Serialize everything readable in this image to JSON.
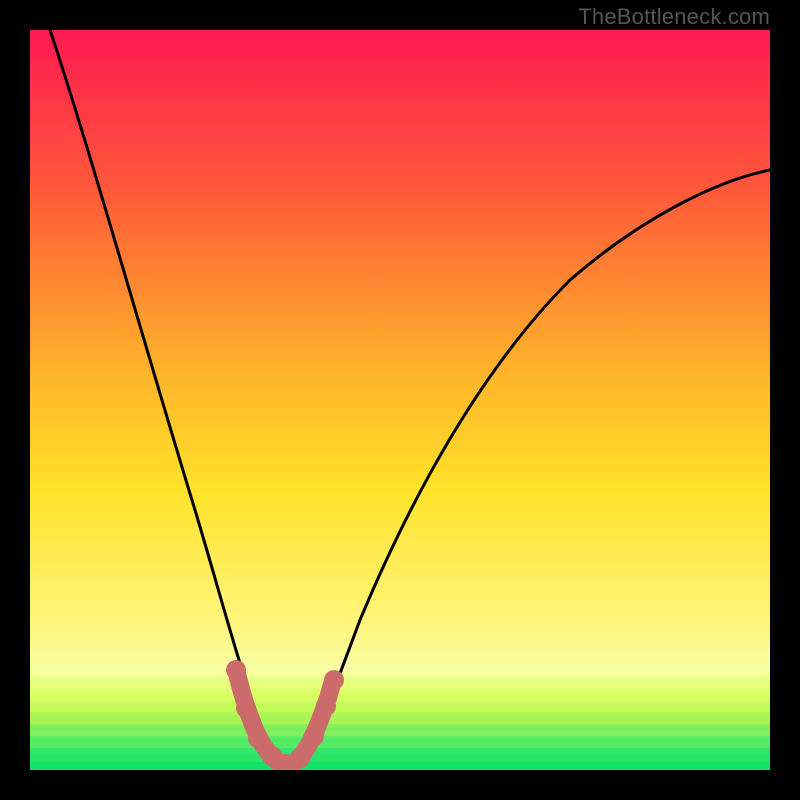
{
  "watermark": "TheBottleneck.com",
  "chart_data": {
    "type": "line",
    "title": "",
    "xlabel": "",
    "ylabel": "",
    "xlim": [
      0,
      100
    ],
    "ylim": [
      0,
      100
    ],
    "gradient_colors": {
      "top": "#ff1a52",
      "upper_mid": "#ff7a2a",
      "mid": "#ffd92a",
      "lower_mid": "#fff59a",
      "bottom_band_top": "#e6ff66",
      "bottom_band_bottom": "#11e36a"
    },
    "series": [
      {
        "name": "bottleneck-curve",
        "x": [
          0,
          5,
          10,
          15,
          20,
          25,
          28,
          30,
          32,
          34,
          36,
          40,
          45,
          50,
          55,
          60,
          65,
          70,
          75,
          80,
          85,
          90,
          95,
          100
        ],
        "y": [
          100,
          83,
          66,
          50,
          35,
          20,
          10,
          5,
          2,
          1,
          2,
          8,
          18,
          30,
          40,
          49,
          57,
          63,
          68,
          72,
          75,
          78,
          80,
          82
        ]
      }
    ],
    "highlight_segment": {
      "name": "optimal-zone",
      "color": "#cc6b6b",
      "x": [
        26,
        27,
        28,
        29,
        30,
        31,
        32,
        33,
        34,
        35,
        36,
        37,
        38,
        39
      ],
      "y": [
        16,
        12,
        9,
        6,
        4,
        2,
        1,
        1,
        2,
        3,
        5,
        7,
        9,
        12
      ]
    }
  }
}
